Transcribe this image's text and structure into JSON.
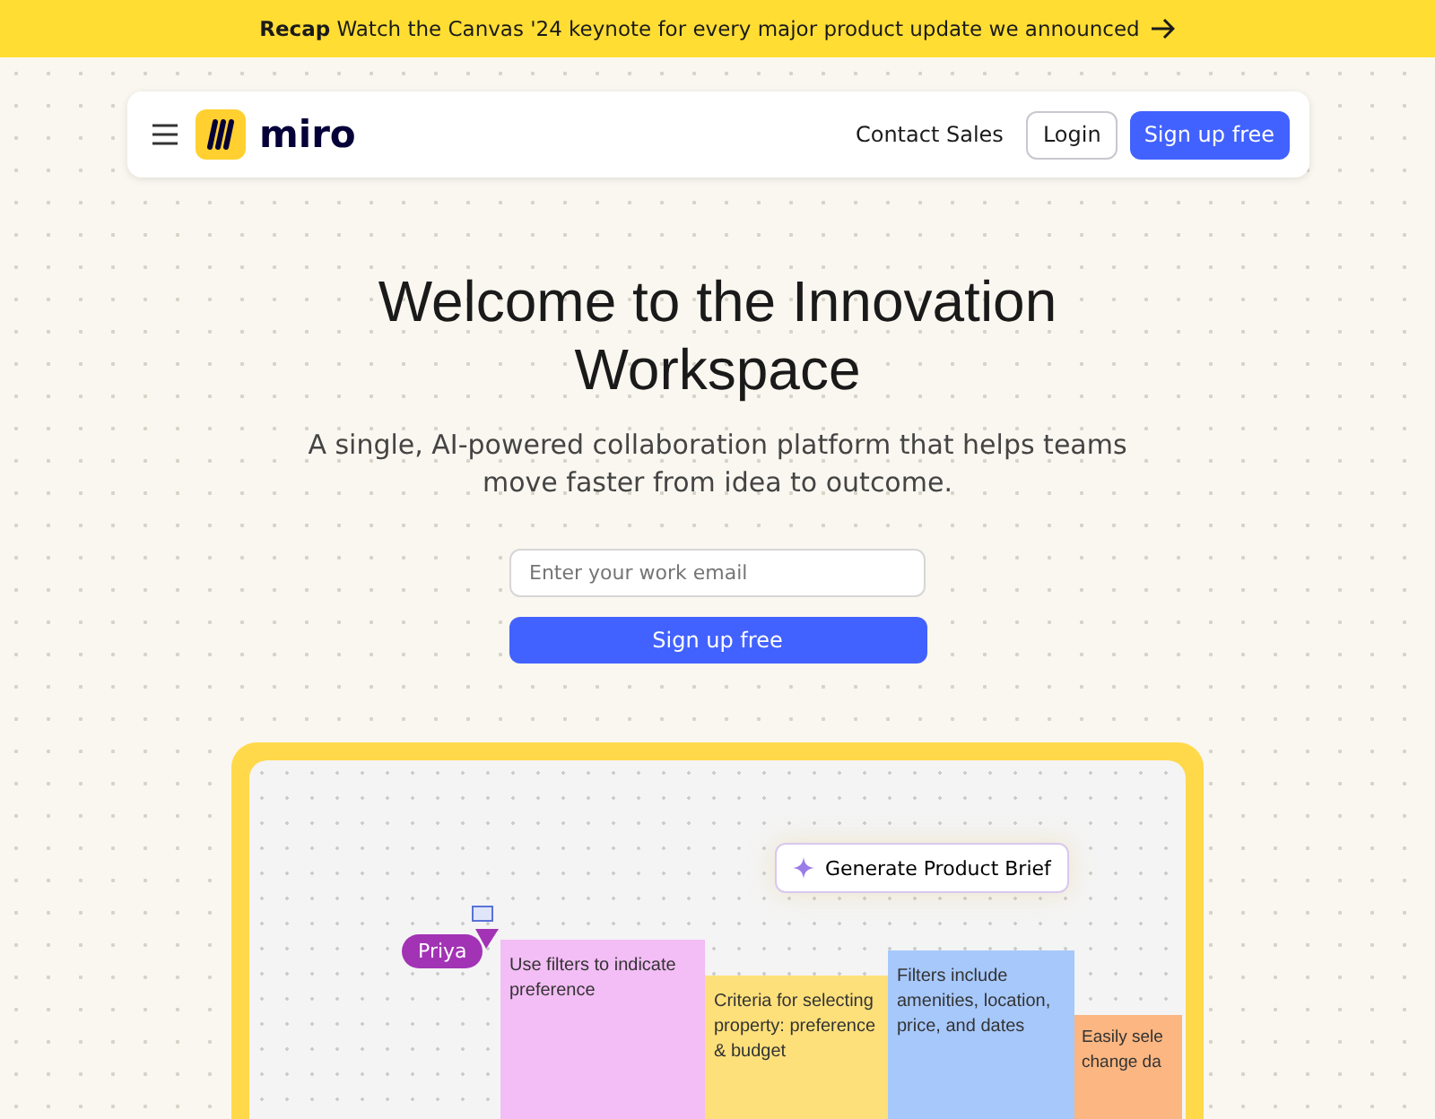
{
  "banner": {
    "text": "**Recap** Watch the Canvas '24 keynote for every major product update we announced"
  },
  "nav": {
    "logo": "miro",
    "links": [
      {
        "label": "Contact Sales",
        "kind": "link"
      },
      {
        "label": "Login",
        "kind": "outline"
      },
      {
        "label": "Sign up free",
        "kind": "primary"
      }
    ]
  },
  "hero": {
    "title": "Welcome to the Innovation Workspace",
    "subtitle": "A single, AI-powered collaboration platform that helps teams move faster from idea to outcome.",
    "email": {
      "placeholder": "Enter your work email"
    },
    "button": "Sign up free"
  },
  "board": {
    "ai_button": "Generate Product Brief",
    "cursor": {
      "name": "Priya",
      "color": "#a233b5"
    },
    "notes": [
      {
        "text": "Use filters to indicate preference",
        "color": "#f3bdf5"
      },
      {
        "text": "Criteria for selecting property: preference & budget",
        "color": "#fde07a"
      },
      {
        "text": "Filters include amenities, location, price, and dates",
        "color": "#a7c8fb"
      },
      {
        "text": "Easily sele change da",
        "color": "#fbb681"
      }
    ]
  }
}
